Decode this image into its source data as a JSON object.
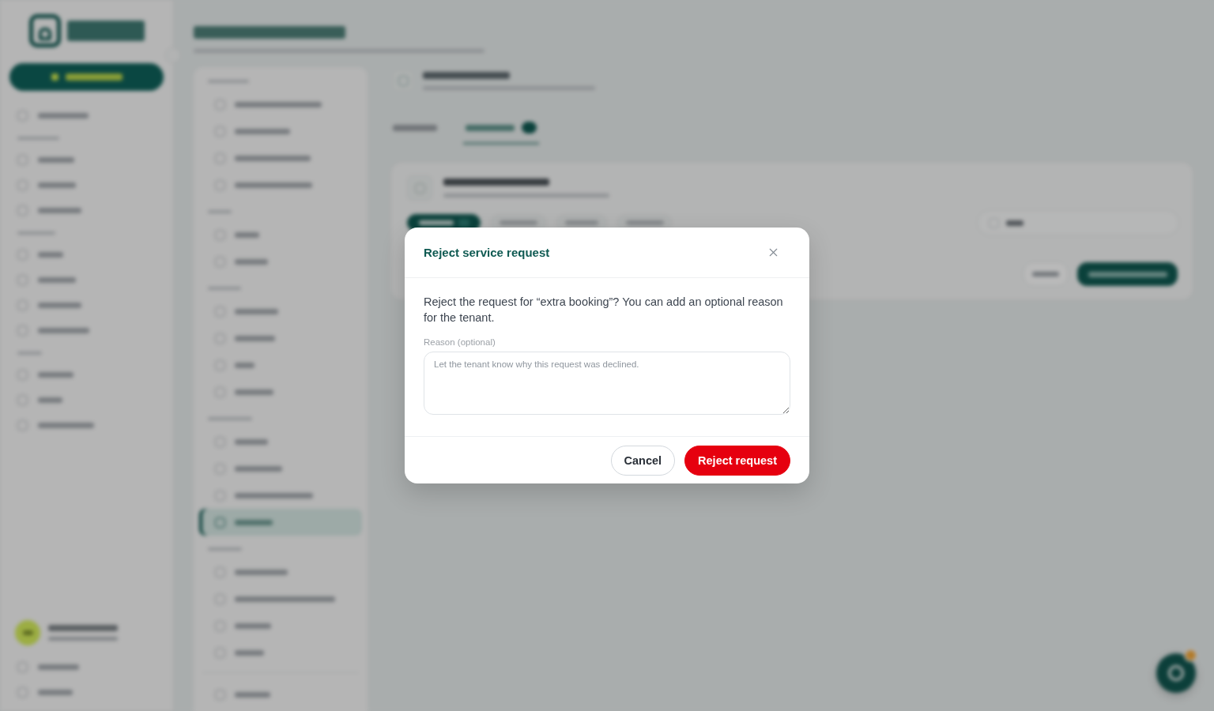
{
  "dialog": {
    "title": "Reject service request",
    "message": "Reject the request for “extra booking”? You can add an optional reason for the tenant.",
    "reason": {
      "label": "Reason (optional)",
      "placeholder": "Let the tenant know why this request was declined."
    },
    "buttons": [
      {
        "kind": "secondary",
        "label": "Cancel"
      },
      {
        "kind": "danger",
        "label": "Reject request"
      }
    ]
  }
}
